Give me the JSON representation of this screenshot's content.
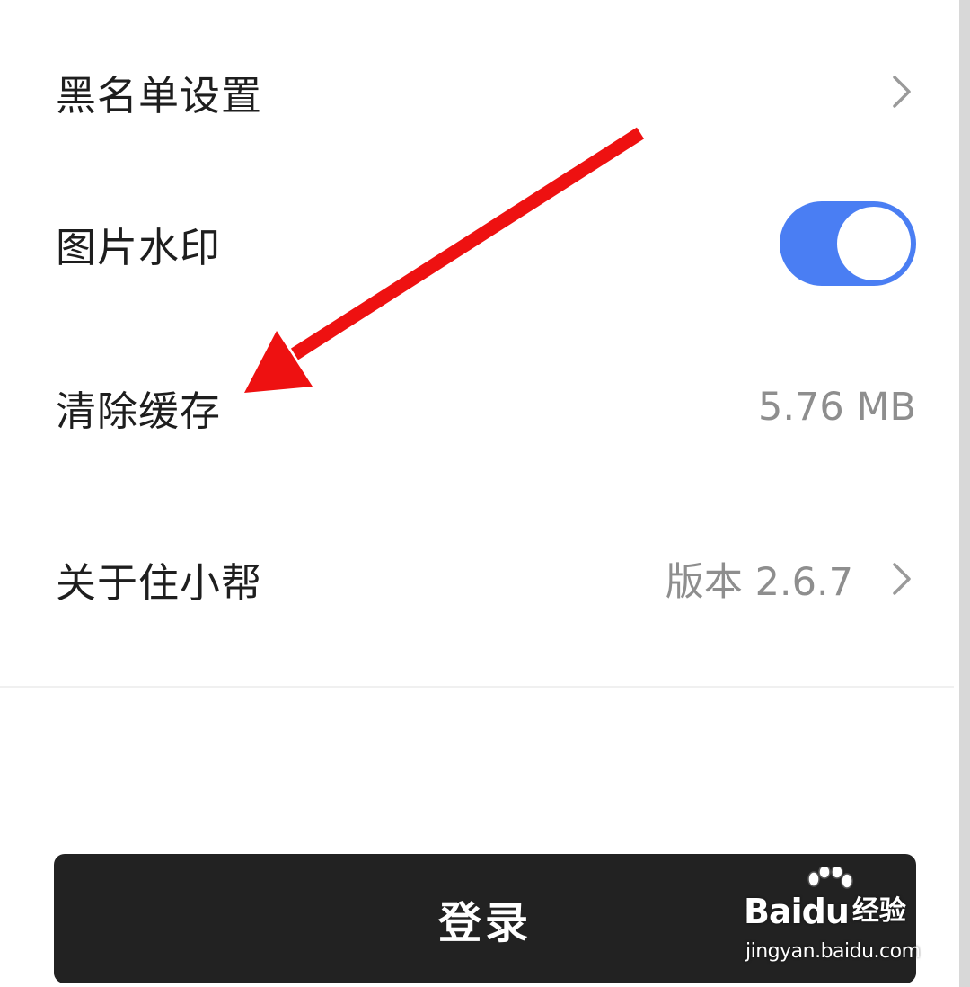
{
  "settings": {
    "rows": [
      {
        "label": "黑名单设置",
        "value": "",
        "has_chevron": true
      },
      {
        "label": "图片水印",
        "toggle_on": true
      },
      {
        "label": "清除缓存",
        "value": "5.76 MB"
      },
      {
        "label": "关于住小帮",
        "value": "版本 2.6.7",
        "has_chevron": true
      }
    ]
  },
  "login": {
    "label": "登录"
  },
  "annotation": {
    "arrow_color": "#ee1111",
    "points_to": "清除缓存"
  },
  "watermark": {
    "brand_part1": "Bai",
    "brand_part2": "du",
    "brand_cn": "经验",
    "url": "jingyan.baidu.com"
  },
  "colors": {
    "toggle_on": "#4a7ef3",
    "button_bg": "#222222",
    "label_text": "#1e1e1e",
    "secondary_text": "#8e8e8e"
  },
  "icons": {
    "chevron": "chevron-right-icon",
    "arrow": "red-arrow-annotation",
    "paw": "baidu-paw-logo"
  }
}
